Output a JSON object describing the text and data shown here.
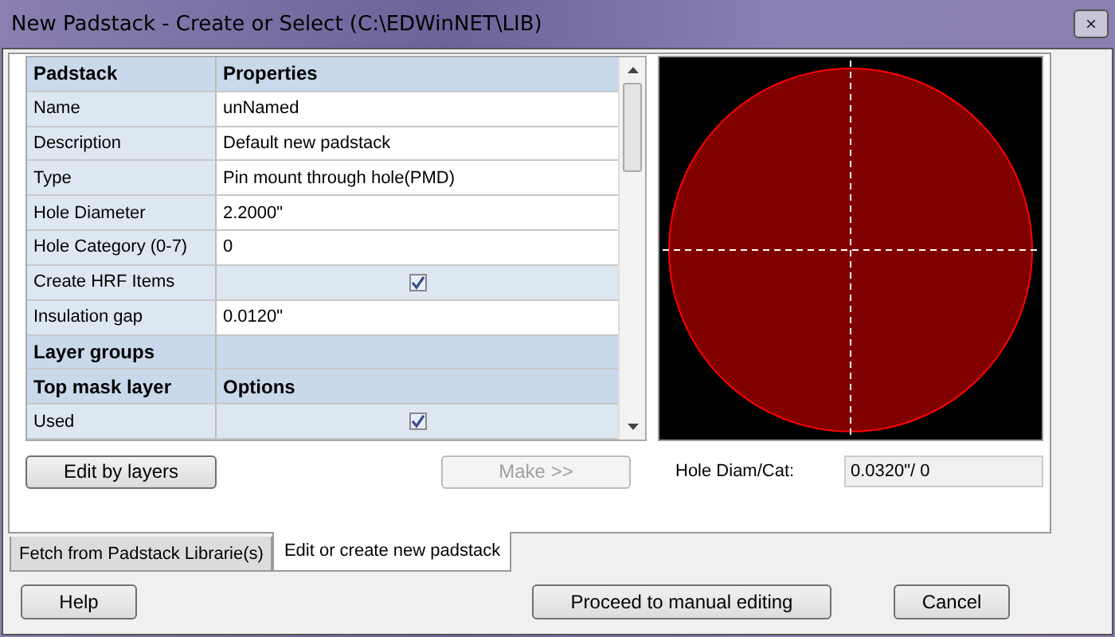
{
  "window": {
    "title": "New Padstack - Create or Select (C:\\EDWinNET\\LIB)",
    "close": "×"
  },
  "table": {
    "rows": [
      {
        "kind": "header",
        "label": "Padstack",
        "value": "Properties"
      },
      {
        "kind": "text",
        "label": "Name",
        "value": "unNamed"
      },
      {
        "kind": "text",
        "label": "Description",
        "value": "Default new padstack"
      },
      {
        "kind": "text",
        "label": "Type",
        "value": "Pin mount through hole(PMD)"
      },
      {
        "kind": "text",
        "label": "Hole Diameter",
        "value": "2.2000\""
      },
      {
        "kind": "text",
        "label": "Hole Category (0-7)",
        "value": "0"
      },
      {
        "kind": "check",
        "label": "Create HRF Items",
        "checked": true
      },
      {
        "kind": "text",
        "label": "Insulation gap",
        "value": "0.0120\""
      },
      {
        "kind": "header",
        "label": "Layer groups"
      },
      {
        "kind": "header",
        "label": "Top mask layer",
        "value": "Options"
      },
      {
        "kind": "check",
        "label": "Used",
        "checked": true
      }
    ]
  },
  "buttons": {
    "edit_by_layers": {
      "label": "Edit by layers",
      "disabled": false
    },
    "make": {
      "label": "Make >>",
      "disabled": true
    }
  },
  "hole_diam_cat": {
    "label": "Hole Diam/Cat:",
    "value": "0.0320\"/ 0"
  },
  "tabs": [
    {
      "label": "Fetch from Padstack Librarie(s)",
      "selected": false
    },
    {
      "label": "Edit or create new padstack",
      "selected": true
    }
  ],
  "footer_buttons": [
    "Help",
    "Proceed to manual editing",
    "Cancel"
  ]
}
